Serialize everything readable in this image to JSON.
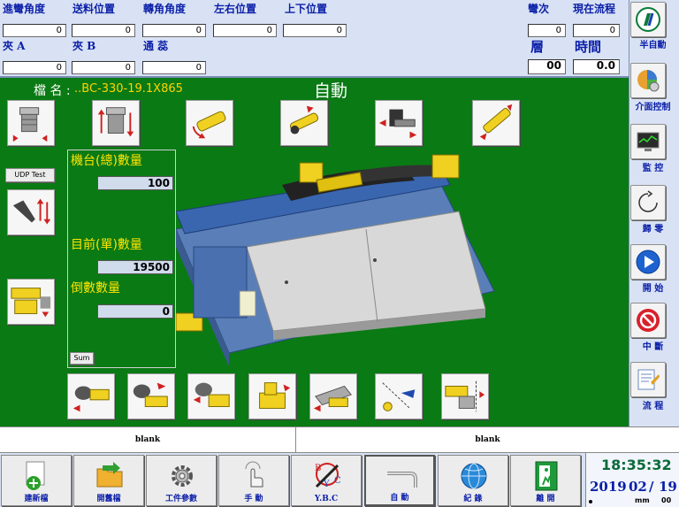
{
  "top": {
    "row1_labels": [
      "進彎角度",
      "送料位置",
      "轉角角度",
      "左右位置",
      "上下位置"
    ],
    "row1_values": [
      "0",
      "0",
      "0",
      "0",
      "0"
    ],
    "bend_label": "彎次",
    "bend_value": "0",
    "process_label": "現在流程",
    "process_value": "0",
    "row2_labels": [
      "夾 A",
      "夾 B",
      "通 蕊"
    ],
    "row2_values": [
      "0",
      "0",
      "0"
    ],
    "layer_label": "層",
    "layer_value": "00",
    "time_label": "時間",
    "time_value": "0.0"
  },
  "main": {
    "filename_label": "檔 名 :",
    "filename_value": "..BC-330-19.1X865",
    "mode_title": "自動",
    "udp_button": "UDP Test",
    "machine_count_label": "機台(總)數量",
    "machine_count_value": "100",
    "current_count_label": "目前(單)數量",
    "current_count_value": "19500",
    "countdown_label": "倒數數量",
    "countdown_value": "0",
    "sum_button": "Sum"
  },
  "sidebar": {
    "items": [
      {
        "label": "半自動",
        "icon": "semi-auto-icon"
      },
      {
        "label": "介面控制",
        "icon": "interface-control-icon"
      },
      {
        "label": "監 控",
        "icon": "monitor-icon"
      },
      {
        "label": "歸 零",
        "icon": "zero-return-icon"
      },
      {
        "label": "開 始",
        "icon": "start-icon"
      },
      {
        "label": "中 斷",
        "icon": "stop-icon"
      },
      {
        "label": "流 程",
        "icon": "process-icon"
      }
    ]
  },
  "blank_bar": {
    "left": "blank",
    "right": "blank"
  },
  "bottom": {
    "buttons": [
      {
        "label": "建新檔",
        "icon": "new-file-icon"
      },
      {
        "label": "開舊檔",
        "icon": "open-file-icon"
      },
      {
        "label": "工件參數",
        "icon": "gear-icon"
      },
      {
        "label": "手 動",
        "icon": "manual-icon"
      },
      {
        "label": "Y.B.C",
        "icon": "ybc-icon"
      },
      {
        "label": "自 動",
        "icon": "auto-icon"
      },
      {
        "label": "紀 錄",
        "icon": "record-icon"
      },
      {
        "label": "離 開",
        "icon": "exit-icon"
      }
    ]
  },
  "clock": {
    "time": "18:35:32",
    "year": "2019",
    "month": "02",
    "day": "19",
    "mm_label": "mm",
    "seconds": "00"
  },
  "colors": {
    "background": "#0a7a14",
    "panel": "#d8e2f4",
    "label_blue": "#0b1fa8",
    "count_yellow": "#ffe400"
  }
}
